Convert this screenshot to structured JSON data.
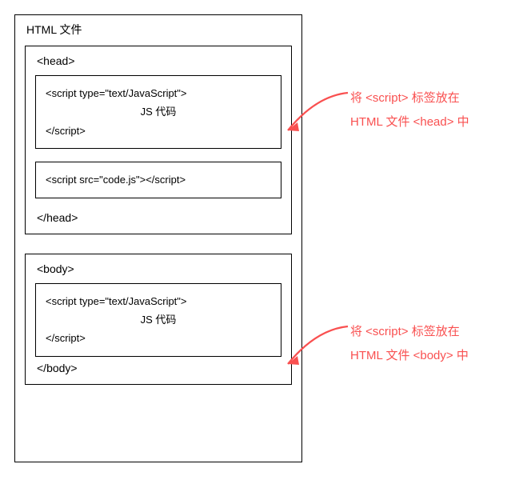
{
  "title": "HTML 文件",
  "head": {
    "open": "<head>",
    "close": "</head>",
    "box1": {
      "line1": "<script type=\"text/JavaScript\">",
      "line2": "JS 代码",
      "line3": "</script>"
    },
    "box2": {
      "line1": "<script src=\"code.js\"></script>"
    }
  },
  "body": {
    "open": "<body>",
    "close": "</body>",
    "box1": {
      "line1": "<script type=\"text/JavaScript\">",
      "line2": "JS 代码",
      "line3": "</script>"
    }
  },
  "annotation1": {
    "line1": "将 <script> 标签放在",
    "line2": "HTML 文件 <head> 中"
  },
  "annotation2": {
    "line1": "将 <script> 标签放在",
    "line2": "HTML 文件 <body> 中"
  }
}
